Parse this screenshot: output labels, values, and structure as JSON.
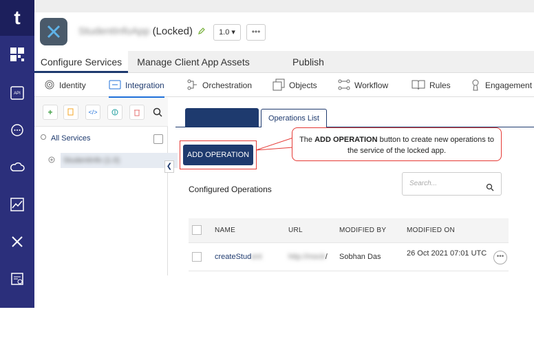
{
  "app": {
    "name_blurred": "StudentInfoApp",
    "locked_label": "(Locked)",
    "version": "1.0 ▾",
    "more": "•••"
  },
  "rail": {
    "logo": "t"
  },
  "primary_tabs": [
    {
      "label": "Configure Services",
      "active": true
    },
    {
      "label": "Manage Client App Assets",
      "active": false
    },
    {
      "label": "Publish",
      "active": false
    }
  ],
  "service_nav": [
    {
      "label": "Identity"
    },
    {
      "label": "Integration",
      "active": true
    },
    {
      "label": "Orchestration"
    },
    {
      "label": "Objects"
    },
    {
      "label": "Workflow"
    },
    {
      "label": "Rules"
    },
    {
      "label": "Engagement"
    }
  ],
  "tree": {
    "all_services": "All Services",
    "service_blurred": "StudentInfo (1.0)"
  },
  "content": {
    "operations_tab": "Operations List",
    "add_operation": "ADD OPERATION",
    "configured_operations": "Configured Operations",
    "search_placeholder": "Search..."
  },
  "callout": {
    "prefix": "The ",
    "bold": "ADD OPERATION",
    "suffix": " button to create new operations to the service of the locked app."
  },
  "table": {
    "headers": [
      "NAME",
      "URL",
      "MODIFIED BY",
      "MODIFIED ON"
    ],
    "rows": [
      {
        "name": "createStud",
        "name_blurred": "ent",
        "url_blurred": "http://mock",
        "url_tail": "/",
        "modified_by": "Sobhan Das",
        "modified_on": "26 Oct 2021 07:01 UTC",
        "more": "•••"
      }
    ]
  },
  "colors": {
    "rail": "#2b2f7b",
    "primary": "#1e3a6e",
    "callout_border": "#e53935"
  }
}
